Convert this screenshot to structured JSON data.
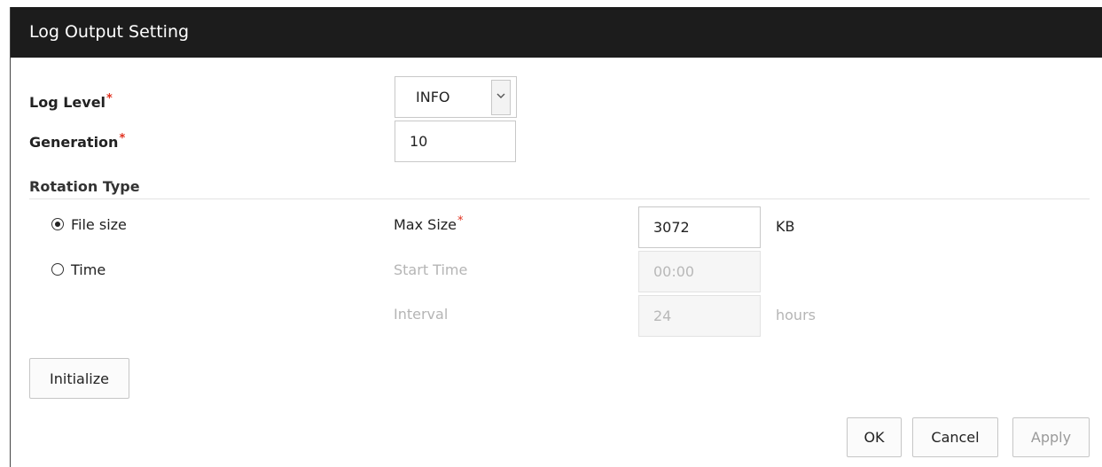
{
  "dialog": {
    "title": "Log Output Setting"
  },
  "form": {
    "log_level": {
      "label": "Log Level",
      "required": "*",
      "value": "INFO"
    },
    "generation": {
      "label": "Generation",
      "required": "*",
      "value": "10"
    },
    "rotation_type": {
      "label": "Rotation Type",
      "options": [
        {
          "label": "File size",
          "selected": true
        },
        {
          "label": "Time",
          "selected": false
        }
      ]
    },
    "max_size": {
      "label": "Max Size",
      "required": "*",
      "value": "3072",
      "unit": "KB"
    },
    "start_time": {
      "label": "Start Time",
      "value": "00:00"
    },
    "interval": {
      "label": "Interval",
      "value": "24",
      "unit": "hours"
    }
  },
  "buttons": {
    "initialize": "Initialize",
    "ok": "OK",
    "cancel": "Cancel",
    "apply": "Apply"
  },
  "colors": {
    "titlebar": "#1c1c1c",
    "required_marker": "#e0301e",
    "disabled_text": "#b5b5b5"
  }
}
